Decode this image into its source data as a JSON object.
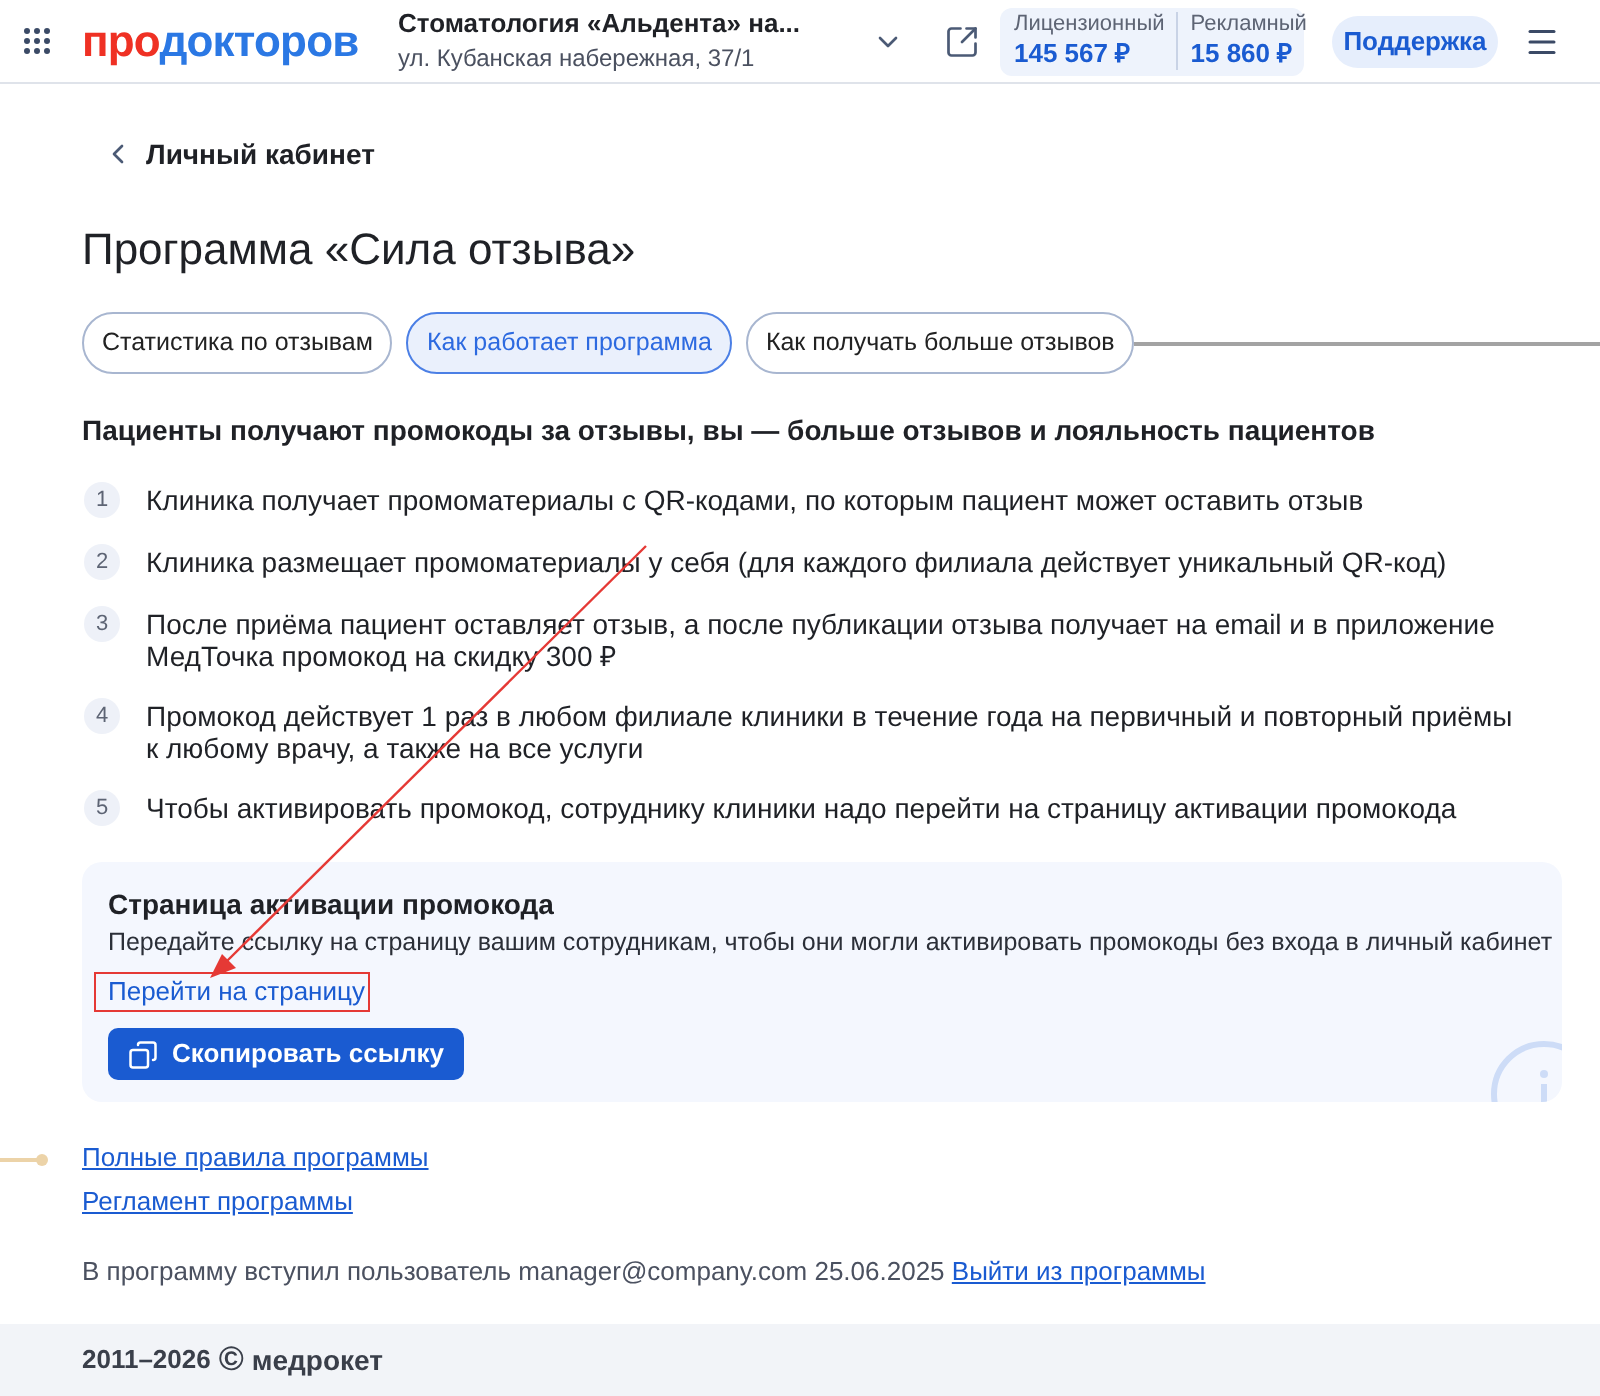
{
  "header": {
    "logo": {
      "first": "про",
      "second": "докторов"
    },
    "clinic": {
      "name": "Стоматология «Альдента» на...",
      "address": "ул. Кубанская набережная, 37/1"
    },
    "balances": [
      {
        "label": "Лицензионный",
        "amount": "145 567 ₽"
      },
      {
        "label": "Рекламный",
        "amount": "15 860 ₽"
      }
    ],
    "support_button": "Поддержка"
  },
  "back_link": "Личный кабинет",
  "title": "Программа «Сила отзыва»",
  "tabs": [
    {
      "label": "Статистика по отзывам",
      "selected": false
    },
    {
      "label": "Как работает программа",
      "selected": true
    },
    {
      "label": "Как получать больше отзывов",
      "selected": false
    }
  ],
  "intro": "Пациенты получают промокоды за отзывы, вы — больше отзывов и лояльность пациентов",
  "steps": [
    {
      "number": "1",
      "text": "Клиника получает промоматериалы с QR-кодами, по которым пациент может оставить отзыв"
    },
    {
      "number": "2",
      "text": "Клиника размещает промоматериалы у себя (для каждого филиала действует уникальный QR-код)"
    },
    {
      "number": "3",
      "text": "После приёма пациент оставляет отзыв, а после публикации отзыва получает на email и в приложение МедТочка промокод на скидку 300 ₽"
    },
    {
      "number": "4",
      "text": "Промокод действует 1 раз в любом филиале клиники в течение года на первичный и повторный приёмы к любому врачу, а также на все услуги"
    },
    {
      "number": "5",
      "text": "Чтобы активировать промокод, сотруднику клиники надо перейти на страницу активации промокода"
    }
  ],
  "activation_card": {
    "title": "Страница активации промокода",
    "description": "Передайте ссылку на страницу вашим сотрудникам, чтобы они могли активировать промокоды без входа в личный кабинет",
    "link": "Перейти на страницу",
    "button": "Скопировать ссылку"
  },
  "links": [
    "Полные правила программы",
    "Регламент программы"
  ],
  "membership": {
    "text": "В программу вступил пользователь manager@company.com 25.06.2025",
    "exit_link": "Выйти из программы"
  },
  "footer": {
    "years": "2011–2026",
    "copyright": "©",
    "brand": "медрокет"
  }
}
